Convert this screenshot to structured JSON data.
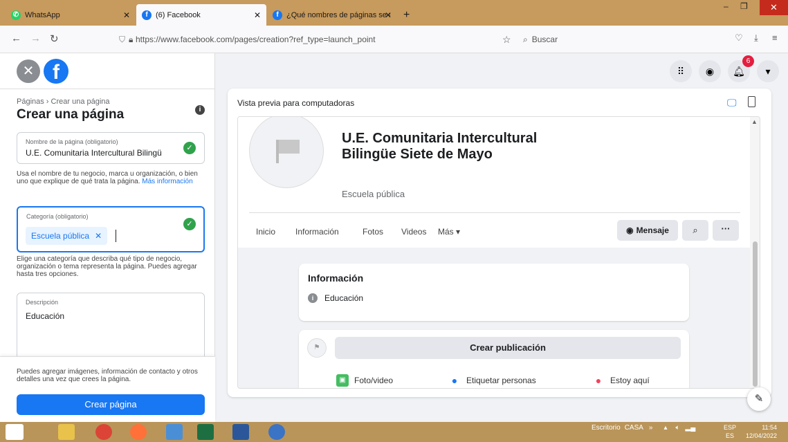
{
  "browser": {
    "tabs": [
      {
        "label": "WhatsApp",
        "active": false
      },
      {
        "label": "(6) Facebook",
        "active": true
      },
      {
        "label": "¿Qué nombres de páginas se ac",
        "active": false
      }
    ],
    "url": "https://www.facebook.com/pages/creation?ref_type=launch_point",
    "search_placeholder": "Buscar"
  },
  "sidebar": {
    "breadcrumb": "Páginas › Crear una página",
    "title": "Crear una página",
    "name_field": {
      "label": "Nombre de la página (obligatorio)",
      "value": "U.E. Comunitaria Intercultural Bilingü"
    },
    "name_help": "Usa el nombre de tu negocio, marca u organización, o bien uno que explique de qué trata la página.",
    "name_help_link": "Más información",
    "category_field": {
      "label": "Categoría (obligatorio)",
      "chip": "Escuela pública"
    },
    "category_help": "Elige una categoría que describa qué tipo de negocio, organización o tema representa la página. Puedes agregar hasta tres opciones.",
    "description_field": {
      "label": "Descripción",
      "value": "Educación"
    },
    "footer_note": "Puedes agregar imágenes, información de contacto y otros detalles una vez que crees la página.",
    "create_button": "Crear página"
  },
  "header_icons": {
    "notification_count": "6"
  },
  "preview": {
    "label": "Vista previa para computadoras",
    "page_name": "U.E. Comunitaria Intercultural Bilingüe Siete de Mayo",
    "page_category": "Escuela pública",
    "nav_tabs": [
      "Inicio",
      "Información",
      "Fotos",
      "Videos",
      "Más ▾"
    ],
    "message_button": "Mensaje",
    "info_card": {
      "title": "Información",
      "item": "Educación"
    },
    "post_card": {
      "create_post": "Crear publicación",
      "actions": [
        "Foto/video",
        "Etiquetar personas",
        "Estoy aquí"
      ]
    }
  },
  "taskbar": {
    "tray_label": "Escritorio",
    "network": "CASA",
    "lang_top": "ESP",
    "lang_bottom": "ES",
    "time": "11:54",
    "date": "12/04/2022"
  }
}
